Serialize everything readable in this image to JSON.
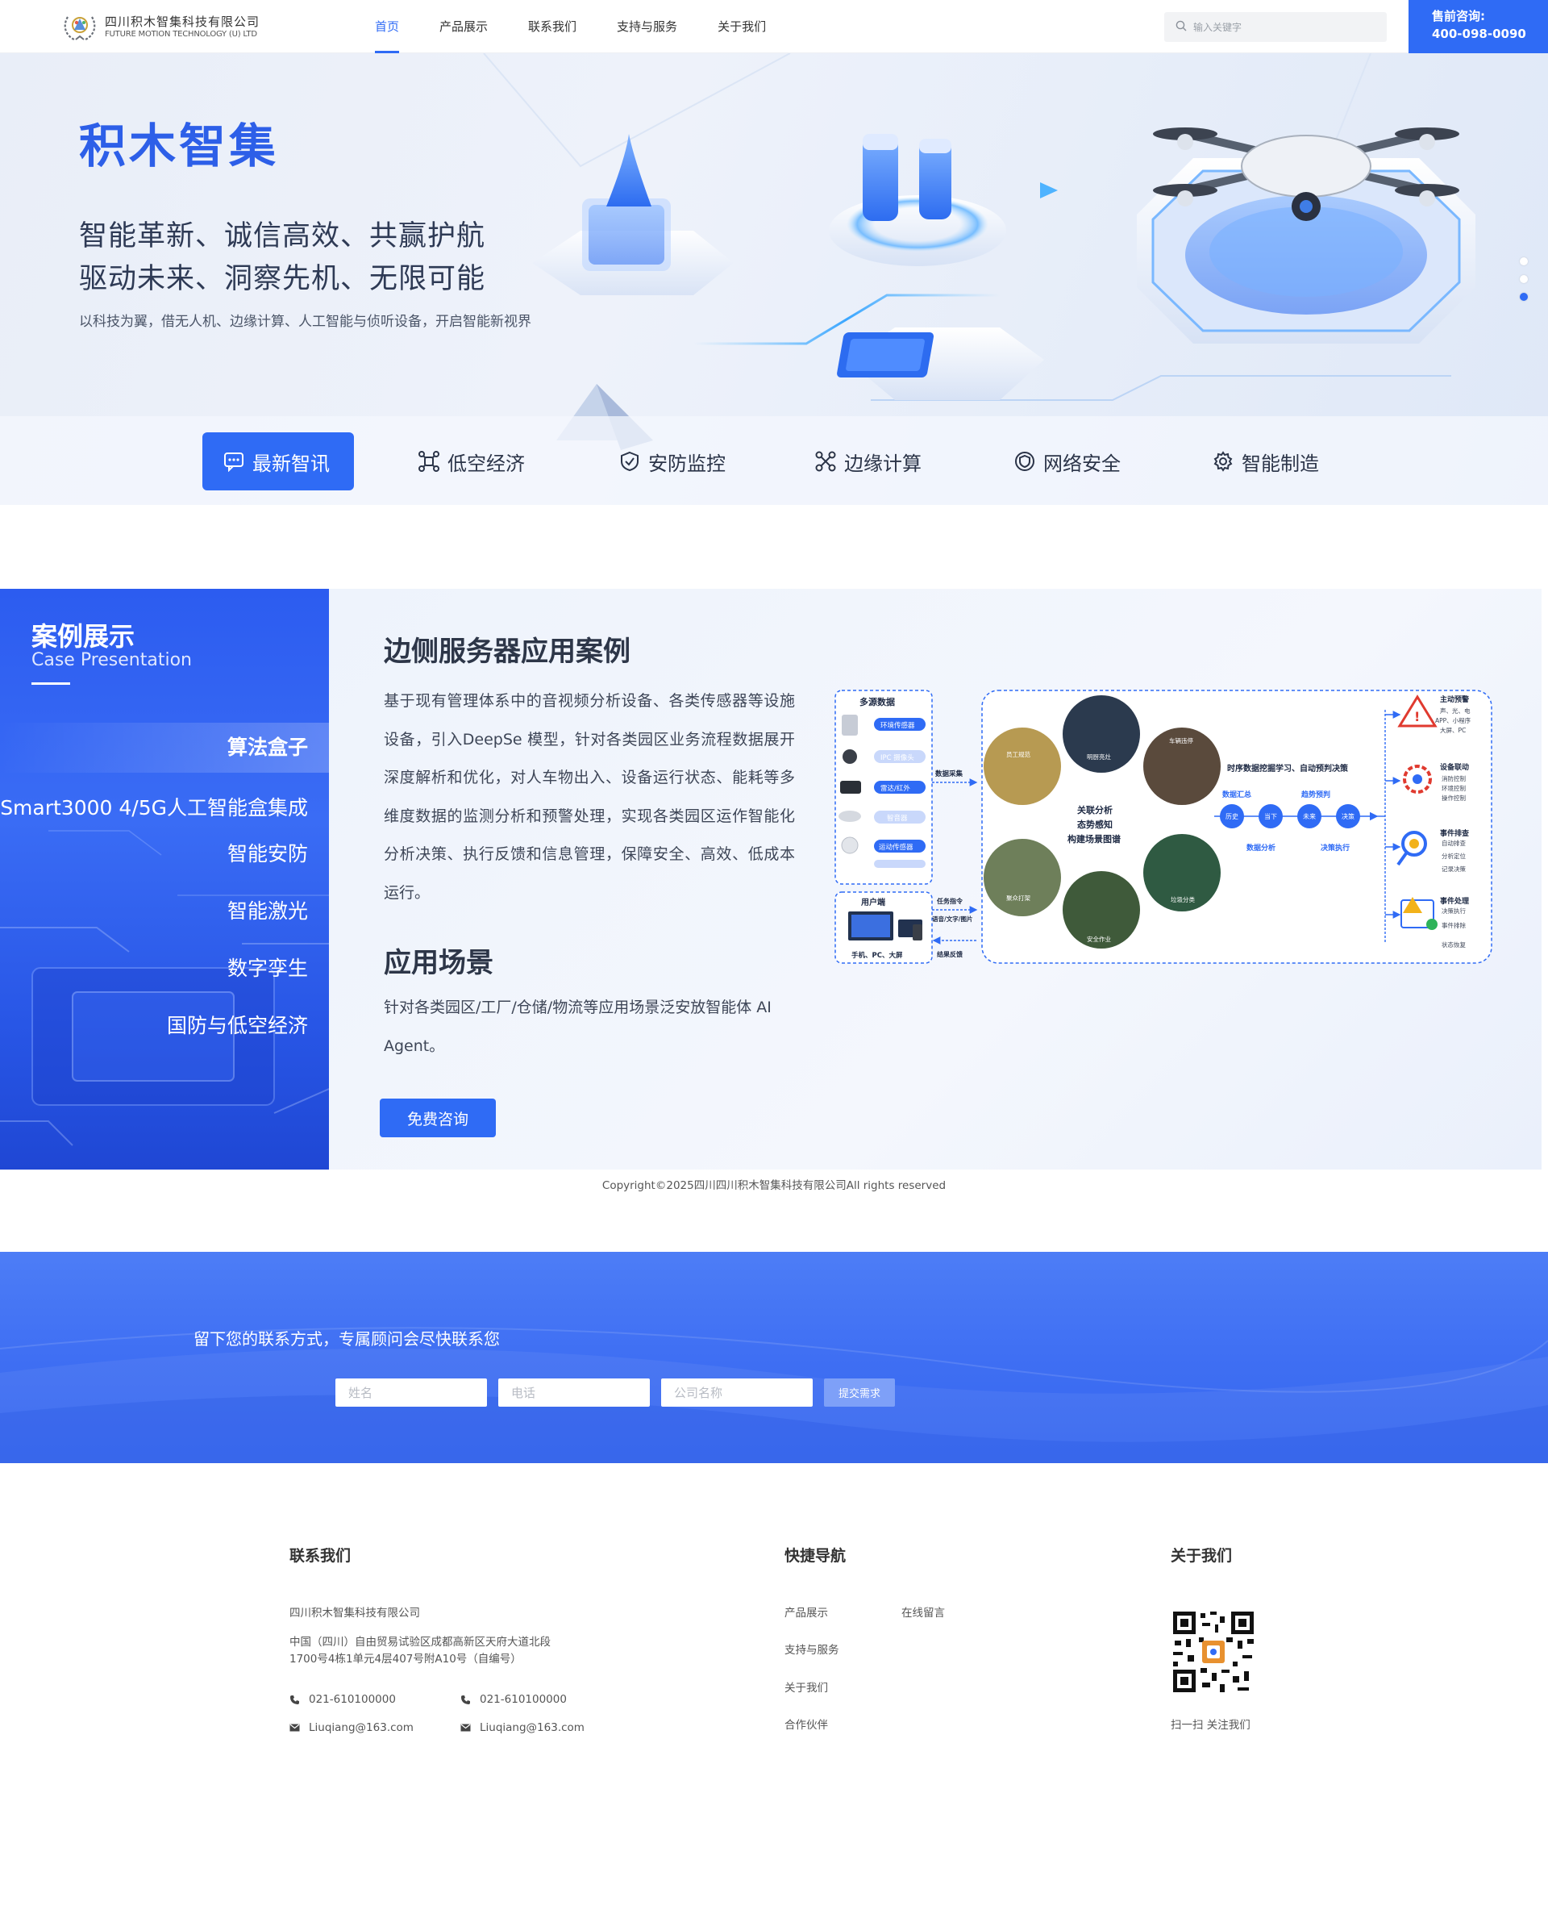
{
  "header": {
    "logo_cn": "四川积木智集科技有限公司",
    "logo_en": "FUTURE MOTION TECHNOLOGY (U) LTD",
    "nav": [
      {
        "label": "首页",
        "active": true
      },
      {
        "label": "产品展示",
        "active": false
      },
      {
        "label": "联系我们",
        "active": false
      },
      {
        "label": "支持与服务",
        "active": false
      },
      {
        "label": "关于我们",
        "active": false
      }
    ],
    "search_placeholder": "输入关键字",
    "hotline_label": "售前咨询:",
    "hotline_number": "400-098-0090"
  },
  "hero": {
    "title": "积木智集",
    "line1": "智能革新、诚信高效、共赢护航",
    "line2": "驱动未来、洞察先机、无限可能",
    "description": "以科技为翼，借无人机、边缘计算、人工智能与侦听设备，开启智能新视界",
    "slide_count": 3,
    "active_slide": 3,
    "categories": [
      {
        "label": "最新智讯",
        "icon": "chat-icon",
        "active": true
      },
      {
        "label": "低空经济",
        "icon": "drone-icon",
        "active": false
      },
      {
        "label": "安防监控",
        "icon": "shield-icon",
        "active": false
      },
      {
        "label": "边缘计算",
        "icon": "network-icon",
        "active": false
      },
      {
        "label": "网络安全",
        "icon": "security-icon",
        "active": false
      },
      {
        "label": "智能制造",
        "icon": "gear-icon",
        "active": false
      }
    ]
  },
  "cases": {
    "title": "案例展示",
    "subtitle": "Case Presentation",
    "items": [
      {
        "label": "算法盒子",
        "active": true
      },
      {
        "label": "Smart3000 4/5G人工智能盒集成",
        "active": false
      },
      {
        "label": "智能安防",
        "active": false
      },
      {
        "label": "智能激光",
        "active": false
      },
      {
        "label": "数字孪生",
        "active": false
      },
      {
        "label": "国防与低空经济",
        "active": false
      }
    ],
    "heading": "边侧服务器应用案例",
    "body": "基于现有管理体系中的音视频分析设备、各类传感器等设施设备，引入DeepSe 模型，针对各类园区业务流程数据展开深度解析和优化，对人车物出入、设备运行状态、能耗等多维度数据的监测分析和预警处理，实现各类园区运作智能化分析决策、执行反馈和信息管理，保障安全、高效、低成本运行。",
    "scenario_heading": "应用场景",
    "scenario_body": "针对各类园区/工厂/仓储/物流等应用场景泛安放智能体 AI Agent。",
    "button": "免费咨询",
    "diagram": {
      "sources_title": "多源数据",
      "sources": [
        "环境传感器",
        "IPC 摄像头",
        "雷达/红外",
        "智音器",
        "运动传感器"
      ],
      "collect_label": "数据采集",
      "user_title": "用户端",
      "user_devices": "手机、PC、大屏",
      "task_label": "任务指令",
      "task_sub": "语音/文字/图片",
      "feedback_label": "结果反馈",
      "center_title": "关联分析",
      "center_line2": "态势感知",
      "center_line3": "构建场景图谱",
      "photo_labels": [
        "明厨亮灶",
        "车辆违停",
        "安全作业",
        "垃圾分类",
        "聚众打架",
        "员工规范"
      ],
      "learning_label": "时序数据挖掘学习、自动预判决策",
      "summary_label": "数据汇总",
      "predict_label": "趋势预判",
      "flow_nodes": [
        "历史",
        "当下",
        "未来",
        "决策"
      ],
      "analysis_label": "数据分析",
      "execute_label": "决策执行",
      "outcomes": [
        {
          "title": "主动预警",
          "lines": [
            "声、光、电",
            "APP、小程序",
            "大屏、PC"
          ]
        },
        {
          "title": "设备联动",
          "lines": [
            "消防控制",
            "环境控制",
            "操作控制"
          ]
        },
        {
          "title": "事件排查",
          "lines": [
            "自动排查",
            "分析定位",
            "记录决策"
          ]
        },
        {
          "title": "事件处理",
          "lines": [
            "决策执行",
            "事件排除",
            "状态恢复"
          ]
        }
      ]
    }
  },
  "contact_form": {
    "prompt": "留下您的联系方式，专属顾问会尽快联系您",
    "name_placeholder": "姓名",
    "phone_placeholder": "电话",
    "company_placeholder": "公司名称",
    "submit": "提交需求"
  },
  "footer": {
    "contact_title": "联系我们",
    "company": "四川积木智集科技有限公司",
    "address_line1": "中国（四川）自由贸易试验区成都高新区天府大道北段",
    "address_line2": "1700号4栋1单元4层407号附A10号（自编号）",
    "phone": "021-610100000",
    "phone2": "021-610100000",
    "email": "Liuqiang@163.com",
    "email2": "Liuqiang@163.com",
    "nav_title": "快捷导航",
    "nav_links": [
      "产品展示",
      "在线留言",
      "支持与服务",
      "关于我们",
      "合作伙伴"
    ],
    "about_title": "关于我们",
    "qr_caption": "扫一扫 关注我们",
    "copyright": "Copyright©2025四川四川积木智集科技有限公司All rights reserved"
  },
  "colors": {
    "brand_blue": "#2f6bf5",
    "hero_title": "#2d5fe8",
    "text_dark": "#2d3648"
  }
}
